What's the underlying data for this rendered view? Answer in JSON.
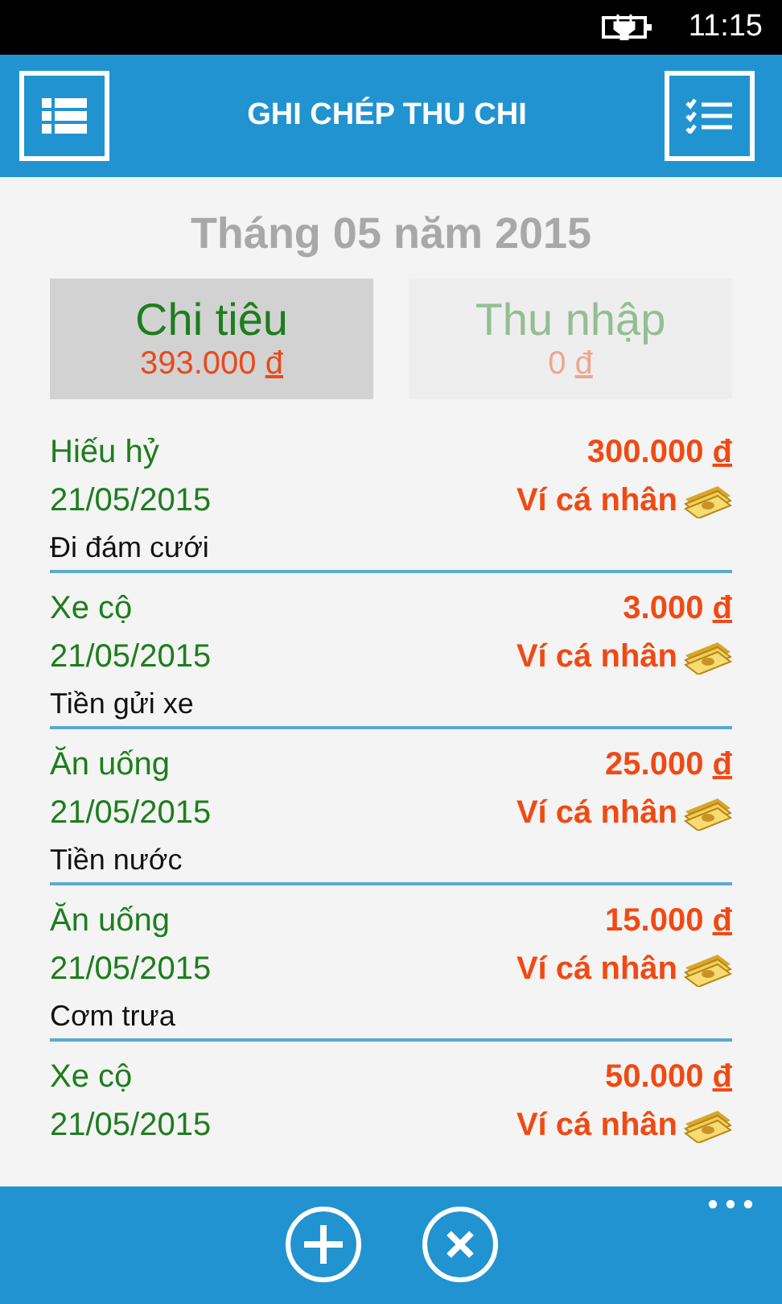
{
  "status_bar": {
    "time": "11:15"
  },
  "header": {
    "title": "GHI CHÉP THU CHI"
  },
  "month_title": "Tháng 05 năm 2015",
  "tabs": [
    {
      "label": "Chi tiêu",
      "amount": "393.000",
      "currency": "đ",
      "selected": true
    },
    {
      "label": "Thu nhập",
      "amount": "0",
      "currency": "đ",
      "selected": false
    }
  ],
  "entries": [
    {
      "category": "Hiếu hỷ",
      "date": "21/05/2015",
      "amount": "300.000",
      "currency": "đ",
      "wallet": "Ví cá nhân",
      "note": "Đi đám cưới"
    },
    {
      "category": "Xe cộ",
      "date": "21/05/2015",
      "amount": "3.000",
      "currency": "đ",
      "wallet": "Ví cá nhân",
      "note": "Tiền gửi xe"
    },
    {
      "category": "Ăn uống",
      "date": "21/05/2015",
      "amount": "25.000",
      "currency": "đ",
      "wallet": "Ví cá nhân",
      "note": "Tiền nước"
    },
    {
      "category": "Ăn uống",
      "date": "21/05/2015",
      "amount": "15.000",
      "currency": "đ",
      "wallet": "Ví cá nhân",
      "note": "Cơm trưa"
    },
    {
      "category": "Xe cộ",
      "date": "21/05/2015",
      "amount": "50.000",
      "currency": "đ",
      "wallet": "Ví cá nhân"
    }
  ]
}
